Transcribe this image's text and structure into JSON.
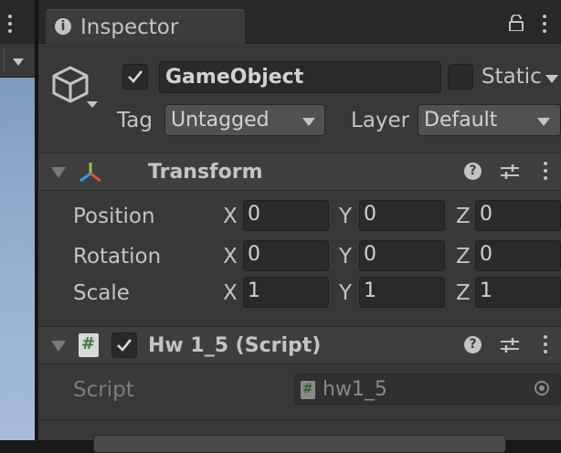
{
  "inspector": {
    "tab_label": "Inspector",
    "header": {
      "name": "GameObject",
      "active_checked": true,
      "static_label": "Static",
      "static_checked": false,
      "tag_label": "Tag",
      "tag_value": "Untagged",
      "layer_label": "Layer",
      "layer_value": "Default"
    },
    "transform": {
      "title": "Transform",
      "position": {
        "label": "Position",
        "x": "0",
        "y": "0",
        "z": "0"
      },
      "rotation": {
        "label": "Rotation",
        "x": "0",
        "y": "0",
        "z": "0"
      },
      "scale": {
        "label": "Scale",
        "x": "1",
        "y": "1",
        "z": "1"
      },
      "axes": {
        "x": "X",
        "y": "Y",
        "z": "Z"
      }
    },
    "script_component": {
      "title": "Hw 1_5 (Script)",
      "enabled_checked": true,
      "script_label": "Script",
      "script_value": "hw1_5",
      "file_glyph": "#"
    }
  },
  "colors": {
    "panel_bg": "#383838",
    "header_bg": "#3e3e3e",
    "field_bg": "#2a2a2a",
    "text": "#c4c4c4",
    "disabled_text": "#7d7d7d",
    "scene_sky": "#93abcd"
  }
}
